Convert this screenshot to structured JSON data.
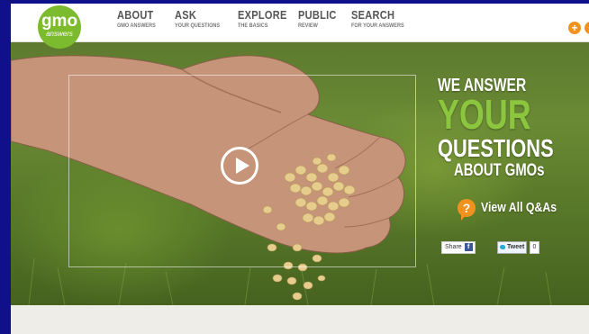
{
  "logo": {
    "main": "gmo",
    "sub": "answers"
  },
  "nav": [
    {
      "title": "ABOUT",
      "sub": "GMO ANSWERS"
    },
    {
      "title": "ASK",
      "sub": "YOUR QUESTIONS"
    },
    {
      "title": "EXPLORE",
      "sub": "THE BASICS"
    },
    {
      "title": "PUBLIC",
      "sub": "REVIEW"
    },
    {
      "title": "SEARCH",
      "sub": "FOR YOUR ANSWERS"
    }
  ],
  "header_icon": {
    "name": "plus-icon",
    "glyph": "+"
  },
  "hero": {
    "line1": "WE ANSWER",
    "line2": "YOUR",
    "line3": "QUESTIONS",
    "line4": "ABOUT GMOs",
    "cta_icon": "?",
    "cta_label": "View All Q&As",
    "share_label": "Share",
    "share_icon": "f",
    "tweet_label": "Tweet",
    "tweet_count": "0",
    "play_icon": "play-icon"
  },
  "colors": {
    "brand_green": "#8cc63f",
    "logo_green": "#7dbb2e",
    "accent_orange": "#f2921e",
    "page_border": "#10108a"
  }
}
